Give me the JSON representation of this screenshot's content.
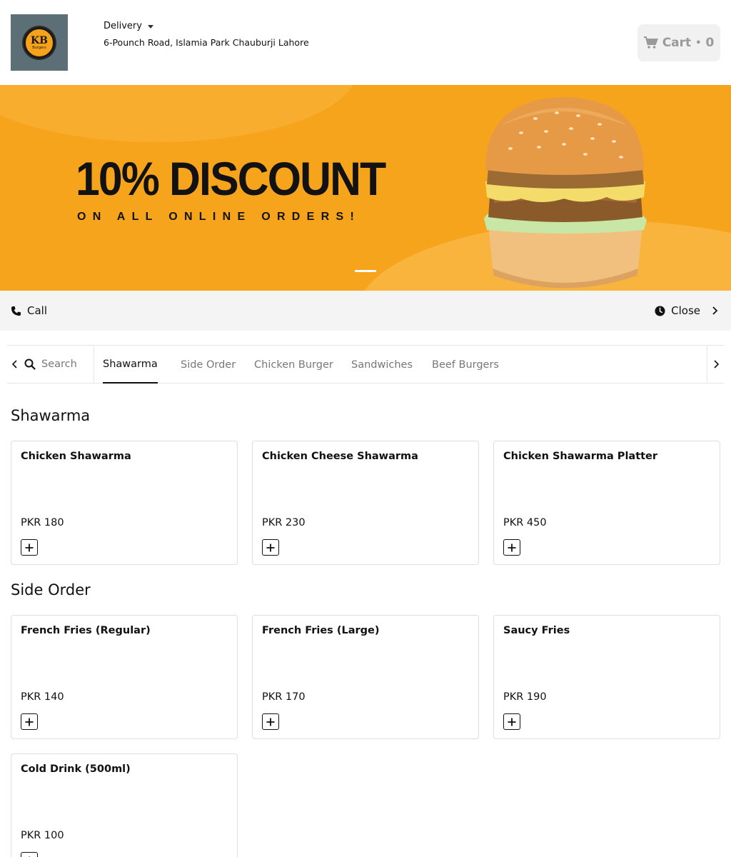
{
  "header": {
    "logo_text": "KB",
    "logo_sub": "Burgers",
    "order_mode": "Delivery",
    "address": "6-Pounch Road, Islamia Park Chauburji Lahore",
    "cart_label": "Cart",
    "cart_separator": "•",
    "cart_count": "0"
  },
  "banner": {
    "title": "10% DISCOUNT",
    "subtitle": "ON ALL ONLINE ORDERS!"
  },
  "actions": {
    "call_label": "Call",
    "hours_label": "Close"
  },
  "nav": {
    "search_placeholder": "Search",
    "tabs": [
      {
        "label": "Shawarma"
      },
      {
        "label": "Side Order"
      },
      {
        "label": "Chicken Burger"
      },
      {
        "label": "Sandwiches"
      },
      {
        "label": "Beef Burgers"
      }
    ]
  },
  "sections": [
    {
      "title": "Shawarma",
      "items": [
        {
          "name": "Chicken Shawarma",
          "price": "PKR 180"
        },
        {
          "name": "Chicken Cheese Shawarma",
          "price": "PKR 230"
        },
        {
          "name": "Chicken Shawarma Platter",
          "price": "PKR 450"
        }
      ]
    },
    {
      "title": "Side Order",
      "items": [
        {
          "name": "French Fries (Regular)",
          "price": "PKR 140"
        },
        {
          "name": "French Fries (Large)",
          "price": "PKR 170"
        },
        {
          "name": "Saucy Fries",
          "price": "PKR 190"
        },
        {
          "name": "Cold Drink (500ml)",
          "price": "PKR 100"
        }
      ]
    }
  ],
  "icons": {
    "caret": "caret-down-icon",
    "cart": "cart-icon",
    "phone": "phone-icon",
    "clock": "clock-icon",
    "chevron_right": "chevron-right-icon",
    "chevron_left": "chevron-left-icon",
    "search": "search-icon",
    "plus": "plus-icon"
  },
  "colors": {
    "banner_bg": "#f7a41d",
    "cart_bg": "#f1f1f1",
    "action_bar_bg": "#f4f4f4"
  }
}
